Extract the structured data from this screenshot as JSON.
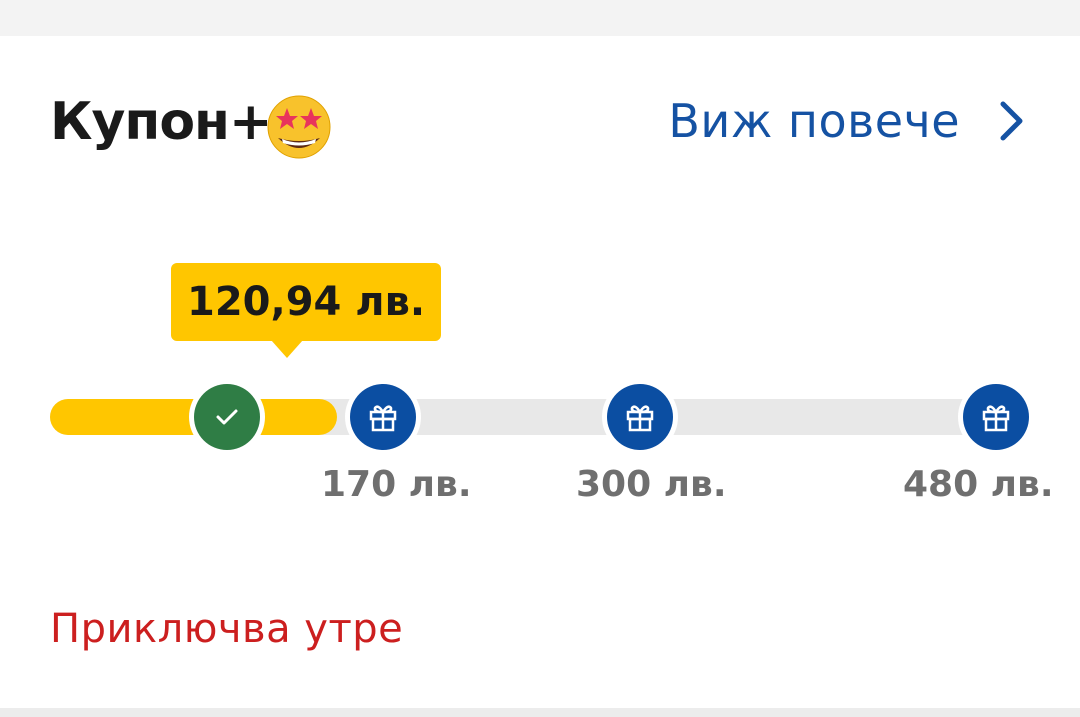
{
  "coupon": {
    "title": "Купон+",
    "emoji_icon": "star-struck-emoji",
    "see_more_label": "Виж повече",
    "current_amount": "120,94 лв.",
    "progress": {
      "current_value": 120.94,
      "max_value": 480
    },
    "milestones": [
      {
        "label": "170 лв.",
        "value": 170,
        "icon": "gift-icon"
      },
      {
        "label": "300 лв.",
        "value": 300,
        "icon": "gift-icon"
      },
      {
        "label": "480 лв.",
        "value": 480,
        "icon": "gift-icon"
      }
    ],
    "expiry_text": "Приключва утре"
  },
  "colors": {
    "accent_yellow": "#ffc600",
    "link_blue": "#1552a3",
    "gift_blue": "#0b4ea2",
    "check_green": "#2f7d45",
    "expiry_red": "#cc1f1f",
    "track_gray": "#e8e8e8"
  }
}
